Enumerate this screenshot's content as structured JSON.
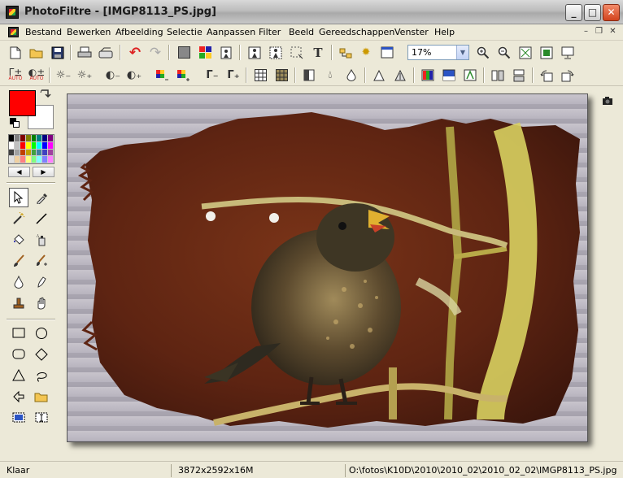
{
  "window": {
    "title": "PhotoFiltre - [IMGP8113_PS.jpg]",
    "minimize_glyph": "_",
    "maximize_glyph": "□",
    "close_glyph": "✕"
  },
  "menu": {
    "items": [
      "Bestand",
      "Bewerken",
      "Afbeelding",
      "Selectie",
      "Aanpassen",
      "Filter",
      "Beeld",
      "Gereedschappen",
      "Venster",
      "Help"
    ],
    "mdi_minimize": "–",
    "mdi_restore": "❐",
    "mdi_close": "✕"
  },
  "toolbar": {
    "zoom_value": "17%",
    "row1_icons": [
      "new-file-icon",
      "open-folder-icon",
      "save-icon",
      "print-icon",
      "scanner-icon",
      "undo-icon",
      "redo-icon",
      "grayscale-icon",
      "palette-icon",
      "transparency-icon",
      "image-size-icon",
      "canvas-size-icon",
      "selection-icon",
      "text-icon",
      "browser-icon",
      "plugin-icon",
      "window-icon",
      "zoom-in-icon",
      "zoom-out-icon",
      "fit-window-icon",
      "actual-size-icon",
      "fullscreen-icon"
    ],
    "row2_icons": [
      "auto-levels-icon",
      "auto-contrast-icon",
      "brightness-minus-icon",
      "brightness-plus-icon",
      "contrast-minus-icon",
      "contrast-plus-icon",
      "saturation-minus-icon",
      "saturation-plus-icon",
      "gamma-minus-icon",
      "gamma-plus-icon",
      "blur-grid-icon",
      "sharpen-grid-icon",
      "levels-icon",
      "drop-icon",
      "drop-outline-icon",
      "triangle-icon",
      "triangle-outline-icon",
      "color-balance-icon",
      "image-icon",
      "effect-icon",
      "flip-vertical-icon",
      "flip-horizontal-icon",
      "rotate-left-icon",
      "rotate-right-icon"
    ],
    "auto_label": "AUTO"
  },
  "colors": {
    "foreground": "#ff0000",
    "background": "#ffffff",
    "palette": [
      "#000000",
      "#808080",
      "#800000",
      "#808000",
      "#008000",
      "#008080",
      "#000080",
      "#800080",
      "#ffffff",
      "#c0c0c0",
      "#ff0000",
      "#ffff00",
      "#00ff00",
      "#00ffff",
      "#0000ff",
      "#ff00ff",
      "#404040",
      "#a0a0a0",
      "#c04000",
      "#c0a000",
      "#40a040",
      "#4080a0",
      "#4040c0",
      "#a040a0",
      "#e0e0e0",
      "#f0d0a0",
      "#ff8080",
      "#ffff80",
      "#80ff80",
      "#80ffff",
      "#8080ff",
      "#ff80ff"
    ]
  },
  "tools": [
    "pointer-icon",
    "eyedropper-icon",
    "magic-wand-icon",
    "line-icon",
    "fill-bucket-icon",
    "spray-icon",
    "brush-icon",
    "advanced-brush-icon",
    "blur-drop-icon",
    "smudge-icon",
    "stamp-icon",
    "hand-icon",
    "rectangle-icon",
    "ellipse-icon",
    "rounded-rect-icon",
    "diamond-icon",
    "triangle-icon",
    "lasso-icon",
    "polygon-lasso-icon",
    "open-icon",
    "select-all-icon",
    "text-select-icon"
  ],
  "status": {
    "state": "Klaar",
    "dimensions": "3872x2592x16M",
    "path": "O:\\fotos\\K10D\\2010\\2010_02\\2010_02_02\\IMGP8113_PS.jpg"
  }
}
